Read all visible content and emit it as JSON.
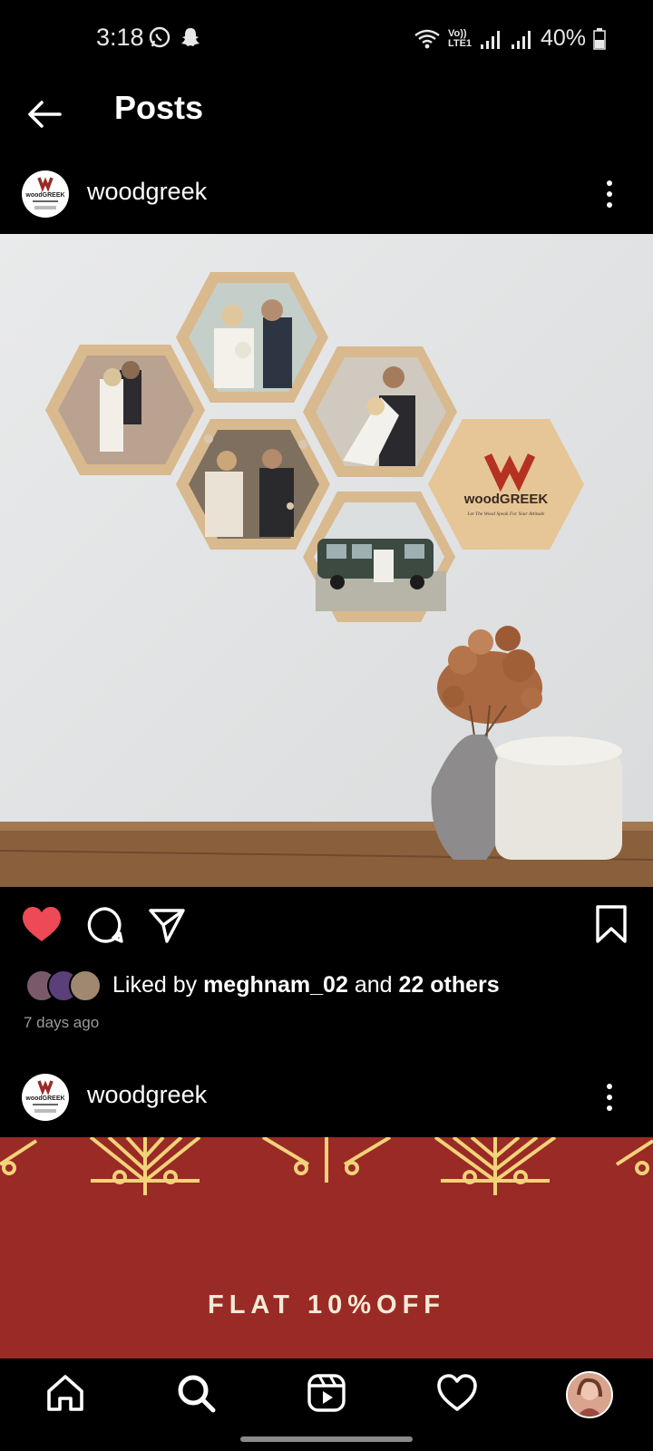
{
  "status_bar": {
    "time": "3:18",
    "network_label": "Vo)) LTE1",
    "battery": "40%",
    "icons": [
      "whatsapp-icon",
      "snapchat-icon",
      "wifi-icon",
      "signal-icon",
      "signal-icon",
      "battery-icon"
    ]
  },
  "header": {
    "title": "Posts"
  },
  "post1": {
    "username": "woodgreek",
    "logo_text": "woodGREEK",
    "image_brand_text": "woodGREEK",
    "image_tagline": "Let The Wood Speak For Your Attitude",
    "liked_by_prefix": "Liked by",
    "liked_by_user": "meghnam_02",
    "liked_by_middle": "and",
    "liked_by_others": "22 others",
    "time_ago": "7 days ago"
  },
  "post2": {
    "username": "woodgreek",
    "logo_text": "woodGREEK",
    "promo_text": "FLAT 10%OFF"
  },
  "colors": {
    "like_red": "#ed4956",
    "promo_bg": "#9a2a25",
    "promo_gold": "#f2d27a"
  },
  "bottom_nav": [
    "home-icon",
    "search-icon",
    "reels-icon",
    "heart-icon",
    "profile-avatar"
  ]
}
